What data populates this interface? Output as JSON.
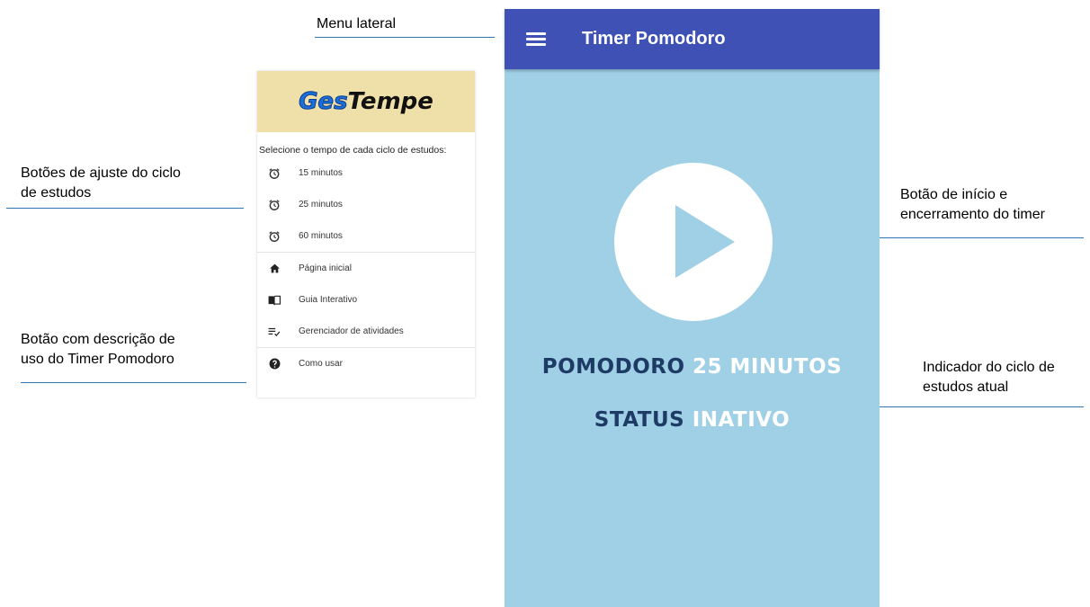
{
  "annotations": {
    "menu": "Menu lateral",
    "cycle_buttons_1": "Botões de ajuste do ciclo",
    "cycle_buttons_2": "de estudos",
    "help_button_1": "Botão com descrição de",
    "help_button_2": "uso do Timer Pomodoro",
    "start_button_1": "Botão de início e",
    "start_button_2": "encerramento do timer",
    "indicator_1": "Indicador do ciclo de",
    "indicator_2": "estudos atual"
  },
  "drawer": {
    "logo_part1": "Ges",
    "logo_part2": "Tempe",
    "caption": "Selecione o tempo de cada ciclo de estudos:",
    "cycles": [
      {
        "label": "15 minutos",
        "icon": "alarm-icon"
      },
      {
        "label": "25 minutos",
        "icon": "alarm-icon"
      },
      {
        "label": "60 minutos",
        "icon": "alarm-icon"
      }
    ],
    "nav": [
      {
        "label": "Página inicial",
        "icon": "home-icon"
      },
      {
        "label": "Guia Interativo",
        "icon": "book-icon"
      },
      {
        "label": "Gerenciador de atividades",
        "icon": "checklist-icon"
      }
    ],
    "help": {
      "label": "Como usar",
      "icon": "help-icon"
    }
  },
  "app": {
    "title": "Timer Pomodoro",
    "pomodoro_label": "POMODORO",
    "pomodoro_value": "25 MINUTOS",
    "status_label": "STATUS",
    "status_value": "INATIVO"
  },
  "colors": {
    "appbar": "#3f51b5",
    "screen_bg": "#a0d0e6",
    "drawer_header": "#efdfa8",
    "leader_lines": "#2e75b6",
    "indicator_dark": "#1e3b66"
  }
}
